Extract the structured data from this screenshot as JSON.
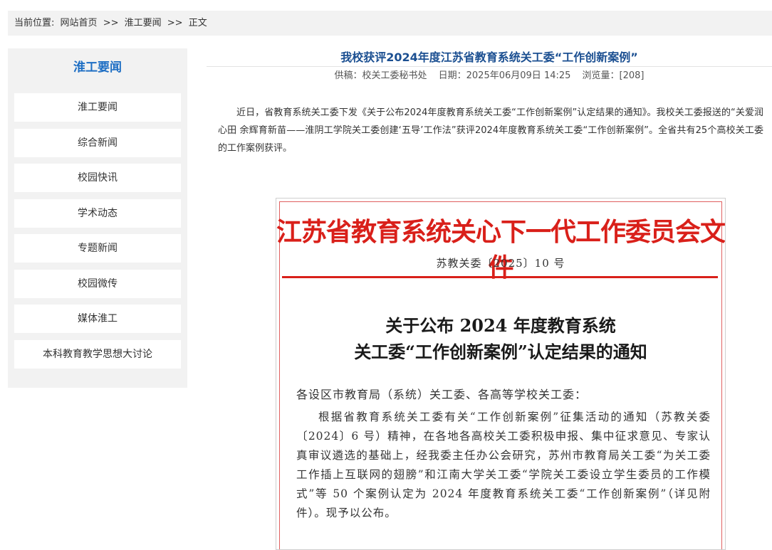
{
  "breadcrumb": {
    "label": "当前位置:",
    "items": [
      "网站首页",
      ">>",
      "淮工要闻",
      ">>",
      "正文"
    ]
  },
  "sidebar": {
    "title": "淮工要闻",
    "items": [
      {
        "label": "淮工要闻"
      },
      {
        "label": "综合新闻"
      },
      {
        "label": "校园快讯"
      },
      {
        "label": "学术动态"
      },
      {
        "label": "专题新闻"
      },
      {
        "label": "校园微传"
      },
      {
        "label": "媒体淮工"
      },
      {
        "label": "本科教育教学思想大讨论"
      }
    ]
  },
  "article": {
    "title": "我校获评2024年度江苏省教育系统关工委“工作创新案例”",
    "meta": {
      "source": "供稿：校关工委秘书处",
      "date": "日期：2025年06月09日 14:25",
      "views": "浏览量：[208]"
    },
    "body": "近日，省教育系统关工委下发《关于公布2024年度教育系统关工委“工作创新案例”认定结果的通知》。我校关工委报送的“关爱润心田 余辉育新苗——淮阴工学院关工委创建‘五导’工作法”获评2024年度教育系统关工委“工作创新案例”。全省共有25个高校关工委的工作案例获评。"
  },
  "document": {
    "header": "江苏省教育系统关心下一代工作委员会文件",
    "number": "苏教关委〔2025〕10 号",
    "title_line1": "关于公布 2024 年度教育系统",
    "title_line2": "关工委“工作创新案例”认定结果的通知",
    "salutation": "各设区市教育局（系统）关工委、各高等学校关工委：",
    "body": "根据省教育系统关工委有关“工作创新案例”征集活动的通知（苏教关委〔2024〕6 号）精神，在各地各高校关工委积极申报、集中征求意见、专家认真审议遴选的基础上，经我委主任办公会研究，苏州市教育局关工委“为关工委工作插上互联网的翅膀”和江南大学关工委“学院关工委设立学生委员的工作模式”等 50 个案例认定为 2024 年度教育系统关工委“工作创新案例”（详见附件）。现予以公布。"
  },
  "colors": {
    "accent_blue": "#1f6fc4",
    "title_blue": "#1b4f91",
    "doc_red": "#d9201a",
    "panel_gray": "#f2f2f2"
  }
}
